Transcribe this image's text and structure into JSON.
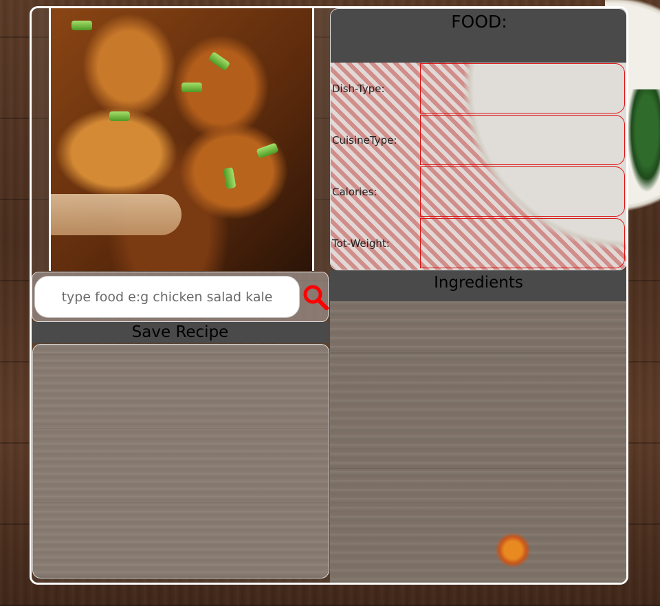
{
  "search": {
    "placeholder": "type food e:g chicken salad kale"
  },
  "icons": {
    "search": "search-icon",
    "search_color": "#ff0000"
  },
  "save_section": {
    "title": "Save Recipe"
  },
  "food_section": {
    "title": "FOOD:",
    "fields": [
      {
        "label": "Dish-Type:",
        "value": ""
      },
      {
        "label": "CuisineType:",
        "value": ""
      },
      {
        "label": "Calories:",
        "value": ""
      },
      {
        "label": "Tot-Weight:",
        "value": ""
      }
    ]
  },
  "ingredients_section": {
    "title": "Ingredients"
  }
}
